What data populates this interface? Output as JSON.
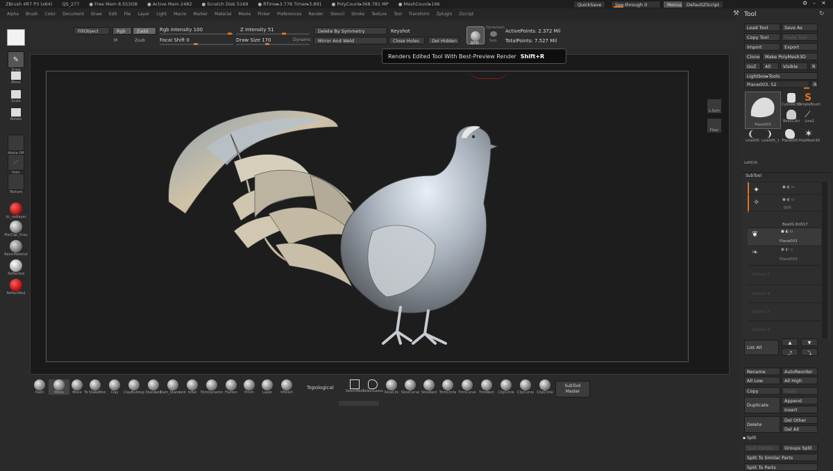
{
  "titlebar": {
    "items": [
      "ZBrush 4R7 P3 (x64)",
      "QS_277",
      "● Free Mem 8.553GB",
      "● Active Mem 2482",
      "● Scratch Disk 5169",
      "● RTime▸3.778 Timer▸3.891",
      "● PolyCount▸368.781 MP",
      "● MeshCount▸196"
    ],
    "quicksave": "QuickSave",
    "seethrough": "See-through 0",
    "menus": "Menus",
    "script": "DefaultZScript"
  },
  "menubar": [
    "Alpha",
    "Brush",
    "Color",
    "Document",
    "Draw",
    "Edit",
    "File",
    "Layer",
    "Light",
    "Macro",
    "Marker",
    "Material",
    "Movie",
    "Picker",
    "Preferences",
    "Render",
    "Stencil",
    "Stroke",
    "Texture",
    "Tool",
    "Transform",
    "Zplugin",
    "Zscript"
  ],
  "topshelf": {
    "fillobject": "FillObject",
    "rgb": "Rgb",
    "zadd": "Zadd",
    "m": "M",
    "zsub": "Zsub",
    "rgb_intensity": "Rgb Intensity 100",
    "focal_shift": "Focal Shift 0",
    "z_intensity": "Z Intensity 51",
    "draw_size": "Draw Size 170",
    "dynamic": "Dynamic",
    "delete_sym": "Delete By Symmetry",
    "mirror_weld": "Mirror And Weld",
    "keyshot": "Keyshot",
    "close_holes": "Close Holes",
    "del_hidden": "Del Hidden",
    "bpr": "BPR",
    "dynamesh": "Dynamesh",
    "solo": "Solo",
    "active_points": "ActivePoints: 2.372 Mil",
    "total_points": "TotalPoints: 7.527 Mil"
  },
  "tooltip": {
    "text": "Renders Edited Tool With Best-Preview Render",
    "shortcut": "Shift+R"
  },
  "leftshelf": {
    "draw": "Draw",
    "move": "Move",
    "scale": "Scale",
    "rotate": "Rotate",
    "alpha": "Alpha Off",
    "dots": "Dots",
    "texture": "Texture",
    "materials": [
      {
        "label": "bc_redlayer",
        "color": "#b01818"
      },
      {
        "label": "MatCap_Gray",
        "color": "#9a9a9a"
      },
      {
        "label": "BasicMaterial",
        "color": "#8c8c8c"
      },
      {
        "label": "Reflected",
        "color": "#b8b8b8"
      },
      {
        "label": "ReflectRed",
        "color": "#c01414"
      }
    ]
  },
  "canvas_side": {
    "lsym": "L.Sym",
    "floor": "Floor"
  },
  "bottomshelf": {
    "brushes": [
      "Paint",
      "Move",
      "Move",
      "To StakeMon",
      "Clay",
      "ClayBuildup",
      "Standard",
      "Dam_Standard",
      "Inflat",
      "TrimDynamic",
      "Flatten",
      "Pinch",
      "Layer",
      "hPolish"
    ],
    "topological": "Topological",
    "tools": [
      "SelectRect",
      "SelectLasso",
      "SliceCirc",
      "SliceCurve",
      "SliceRect",
      "TrimCircle",
      "TrimCurve",
      "TrimRect",
      "ClipCircle",
      "ClipCurve",
      "ClipCircle"
    ],
    "subtool_master": "SubTool Master"
  },
  "rightpanel": {
    "title": "Tool",
    "load_tool": "Load Tool",
    "save_as": "Save As",
    "copy_tool": "Copy Tool",
    "paste_tool": "Paste Tool",
    "import": "Import",
    "export": "Export",
    "clone": "Clone",
    "make_polymesh": "Make PolyMesh3D",
    "goz": "GoZ",
    "all": "All",
    "visible": "Visible",
    "r": "R",
    "lightbox_tools": "Lightbox▸Tools",
    "current_tool": "Plane003. 52",
    "thumbs": [
      "Plane003",
      "Cylinder3D",
      "SimpleBrush",
      "Box01.6ri",
      "Line2",
      "Line005",
      "Line005_1",
      "Plane005",
      "PolyMesh3D"
    ],
    "left016": "Left016",
    "subtool_title": "SubTool",
    "subtools": [
      "",
      "00X",
      "Box01.6ri017",
      "Plane003",
      "Plane003"
    ],
    "empty_slots": [
      "Subtool 5",
      "Subtool 6",
      "Subtool 7",
      "Subtool 8"
    ],
    "list_all": "List All",
    "rename": "Rename",
    "autoreorder": "AutoReorder",
    "all_low": "All Low",
    "all_high": "All High",
    "copy": "Copy",
    "paste": "Paste",
    "append": "Append",
    "duplicate": "Duplicate",
    "insert": "Insert",
    "delete": "Delete",
    "del_other": "Del Other",
    "del_all": "Del All",
    "split_title": "Split",
    "split_hidden": "Split Hidden",
    "groups_split": "Groups Split",
    "split_similar": "Split To Similar Parts",
    "split_parts": "Split To Parts"
  },
  "colors": {
    "accent": "#e2741e",
    "canvas": "#1a1a1a",
    "panel": "#2b2b2b"
  }
}
